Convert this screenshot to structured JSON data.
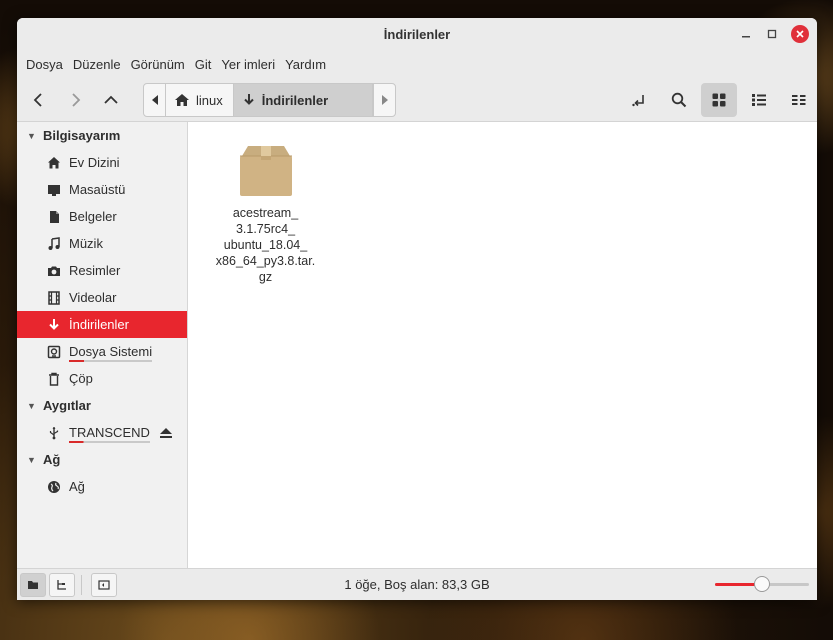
{
  "window": {
    "title": "İndirilenler",
    "controls": {
      "minimize_icon": "minimize-icon",
      "maximize_icon": "maximize-icon",
      "close_icon": "close-icon"
    }
  },
  "menu": [
    "Dosya",
    "Düzenle",
    "Görünüm",
    "Git",
    "Yer imleri",
    "Yardım"
  ],
  "pathbar": {
    "segments": [
      {
        "label": "linux",
        "icon": "home-icon"
      },
      {
        "label": "İndirilenler",
        "icon": "download-icon",
        "active": true
      }
    ]
  },
  "sidebar": {
    "sections": [
      {
        "title": "Bilgisayarım",
        "items": [
          {
            "label": "Ev Dizini",
            "icon": "home-icon"
          },
          {
            "label": "Masaüstü",
            "icon": "desktop-icon"
          },
          {
            "label": "Belgeler",
            "icon": "document-icon"
          },
          {
            "label": "Müzik",
            "icon": "music-icon"
          },
          {
            "label": "Resimler",
            "icon": "camera-icon"
          },
          {
            "label": "Videolar",
            "icon": "film-icon"
          },
          {
            "label": "İndirilenler",
            "icon": "download-icon",
            "active": true
          },
          {
            "label": "Dosya Sistemi",
            "icon": "drive-icon"
          },
          {
            "label": "Çöp",
            "icon": "trash-icon"
          }
        ]
      },
      {
        "title": "Aygıtlar",
        "items": [
          {
            "label": "TRANSCEND",
            "icon": "usb-icon",
            "eject_icon": "eject-icon"
          }
        ]
      },
      {
        "title": "Ağ",
        "items": [
          {
            "label": "Ağ",
            "icon": "network-icon"
          }
        ]
      }
    ]
  },
  "files": [
    {
      "name_lines": [
        "acestream_",
        "3.1.75rc4_",
        "ubuntu_18.04_",
        "x86_64_py3.8.tar.",
        "gz"
      ],
      "icon": "archive-icon"
    }
  ],
  "statusbar": {
    "text": "1 öğe, Boş alan: 83,3 GB",
    "zoom_level": 0.5
  },
  "colors": {
    "accent": "#e8262e",
    "window_bg": "#ebebeb",
    "sidebar_bg": "#f1f1f1"
  }
}
